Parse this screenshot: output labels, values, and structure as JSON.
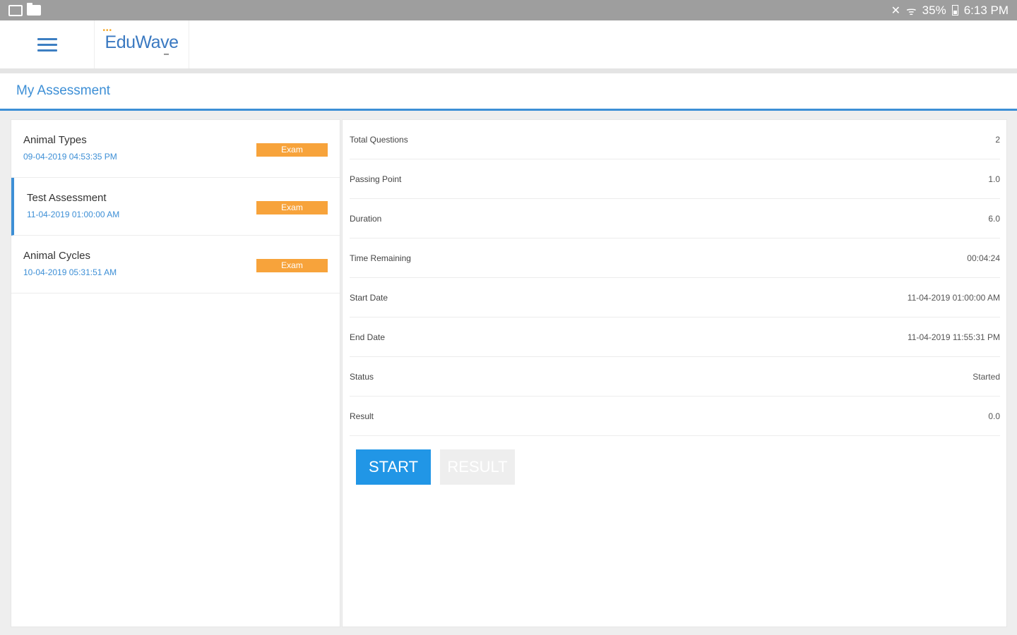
{
  "status_bar": {
    "battery": "35%",
    "time": "6:13 PM",
    "icons": [
      "image-icon",
      "folder-icon",
      "mute-icon",
      "wifi-icon",
      "battery-icon"
    ]
  },
  "header": {
    "logo_text": "EduWave",
    "menu_icon": "hamburger-icon"
  },
  "page": {
    "title": "My Assessment"
  },
  "assessments": [
    {
      "name": "Animal Types",
      "date": "09-04-2019 04:53:35 PM",
      "badge": "Exam"
    },
    {
      "name": "Test Assessment",
      "date": "11-04-2019 01:00:00 AM",
      "badge": "Exam"
    },
    {
      "name": "Animal Cycles",
      "date": "10-04-2019 05:31:51 AM",
      "badge": "Exam"
    }
  ],
  "details": [
    {
      "label": "Total Questions",
      "value": "2"
    },
    {
      "label": "Passing Point",
      "value": "1.0"
    },
    {
      "label": "Duration",
      "value": "6.0"
    },
    {
      "label": "Time Remaining",
      "value": "00:04:24"
    },
    {
      "label": "Start Date",
      "value": "11-04-2019 01:00:00 AM"
    },
    {
      "label": "End Date",
      "value": "11-04-2019 11:55:31 PM"
    },
    {
      "label": "Status",
      "value": "Started"
    },
    {
      "label": "Result",
      "value": "0.0"
    }
  ],
  "actions": {
    "start_label": "START",
    "result_label": "RESULT"
  },
  "colors": {
    "accent": "#3d8fd6",
    "button": "#2196e6",
    "badge": "#f7a33b",
    "status_bar": "#9e9e9e"
  }
}
